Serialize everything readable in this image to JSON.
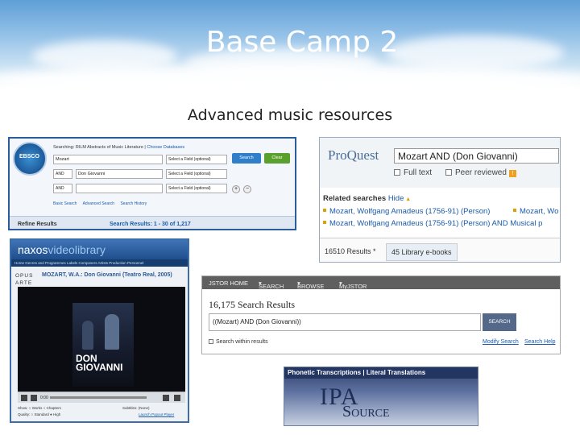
{
  "slide": {
    "title": "Base Camp 2",
    "subtitle": "Advanced music resources"
  },
  "ebsco": {
    "logo_text": "EBSCO",
    "searching_prefix": "Searching: RILM Abstracts of Music Literature",
    "choose_databases": "Choose Databases",
    "rows": [
      {
        "op": "",
        "term": "Mozart",
        "field": "Select a Field (optional)"
      },
      {
        "op": "AND",
        "term": "Don Giovanni",
        "field": "Select a Field (optional)"
      },
      {
        "op": "AND",
        "term": "",
        "field": "Select a Field (optional)"
      }
    ],
    "search_button": "Search",
    "clear_button": "Clear",
    "links": [
      "Basic Search",
      "Advanced Search",
      "Search History"
    ],
    "refine_results": "Refine Results",
    "search_results": "Search Results: 1 - 30 of 1,217"
  },
  "proquest": {
    "logo": "ProQuest",
    "query": "Mozart AND (Don Giovanni)",
    "full_text": "Full text",
    "peer_reviewed": "Peer reviewed",
    "related_label": "Related searches",
    "hide": "Hide",
    "related": [
      "Mozart, Wolfgang Amadeus (1756-91) (Person)",
      "Mozart, Wolfgang Amadeus (1756-91) (Person) AND Musical p"
    ],
    "related_extra": "Mozart, Wo",
    "results_tab": "16510 Results *",
    "library_tab": "45 Library e-books"
  },
  "naxos": {
    "logo_a": "naxos",
    "logo_b": "videolibrary",
    "nav": "Home  Genres and Programmes  Labels  Composers  Artists  Production Personnel",
    "label_line1": "OPUS",
    "label_line2": "ARTE",
    "title": "MOZART, W.A.: Don Giovanni (Teatro Real, 2005)",
    "poster_title_1": "DON",
    "poster_title_2": "GIOVANNI",
    "time": "0:00",
    "show_label": "Show:",
    "works": "Works",
    "chapters": "Chapters",
    "quality_label": "Quality:",
    "standard": "Standard",
    "high": "High",
    "subtitles_label": "Subtitles:",
    "subtitles_value": "(None)",
    "launch": "Launch Popout Player"
  },
  "jstor": {
    "nav": [
      "JSTOR HOME",
      "SEARCH",
      "BROWSE",
      "MyJSTOR"
    ],
    "count": "16,175 Search Results",
    "query": "((Mozart) AND (Don Giovanni))",
    "search_button": "SEARCH",
    "within": "Search within results",
    "modify": "Modify Search",
    "help": "Search Help"
  },
  "ipa": {
    "bar": "Phonetic Transcriptions  |  Literal Translations",
    "logo_ipa": "IPA",
    "logo_source": "Source"
  }
}
